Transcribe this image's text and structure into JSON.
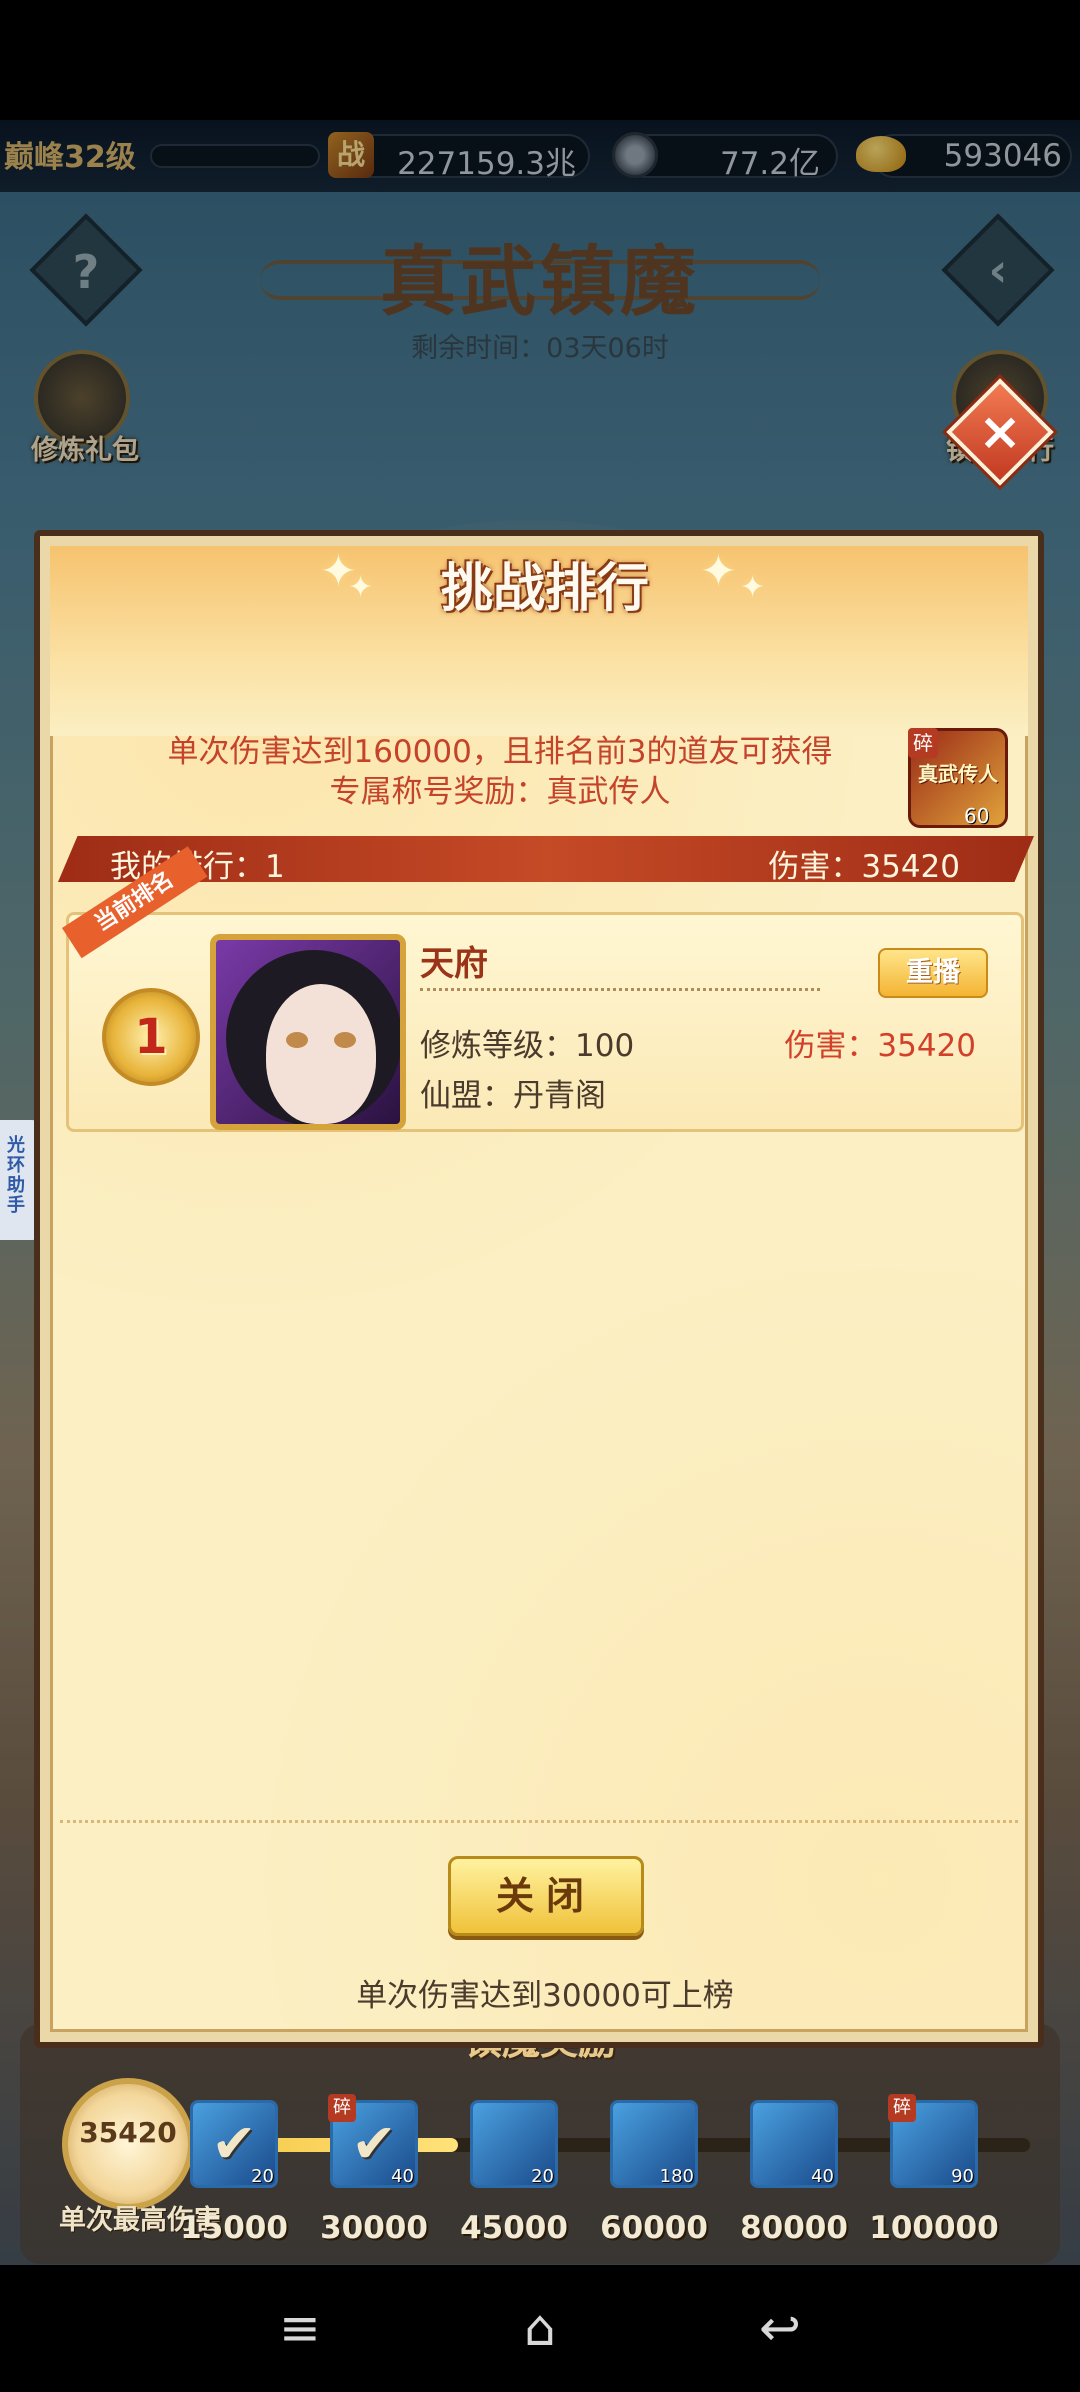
{
  "resources": {
    "level": "巅峰32级",
    "power_icon": "战",
    "power": "227159.3兆",
    "coins": "77.2亿",
    "ingots": "593046"
  },
  "header": {
    "title": "真武镇魔",
    "remaining_time": "剩余时间：03天06时"
  },
  "side": {
    "left_label": "修炼礼包",
    "right_label": "镇魔排行",
    "assist_tab": "光环助手"
  },
  "dialog": {
    "title": "挑战排行",
    "reward_line1": "单次伤害达到160000，且排名前3的道友可获得",
    "reward_line2": "专属称号奖励：真武传人",
    "badge_fragment": "碎",
    "badge_text": "真武传人",
    "badge_count": "60",
    "my_rank": "我的排行：1",
    "my_damage": "伤害：35420",
    "entry": {
      "ribbon": "当前排名",
      "rank": "1",
      "name": "天府",
      "level": "修炼等级：100",
      "alliance": "仙盟：丹青阁",
      "damage": "伤害：35420",
      "replay": "重播"
    },
    "close_button": "关闭",
    "threshold": "单次伤害达到30000可上榜"
  },
  "rewards": {
    "title": "镇魔奖励",
    "best_value": "35420",
    "best_label": "单次最高伤害",
    "progress": 0.35,
    "milestones": [
      {
        "value": "15000",
        "count": "20",
        "claimed": true,
        "fragment": false
      },
      {
        "value": "30000",
        "count": "40",
        "claimed": true,
        "fragment": true
      },
      {
        "value": "45000",
        "count": "20",
        "claimed": false,
        "fragment": false
      },
      {
        "value": "60000",
        "count": "180",
        "claimed": false,
        "fragment": false
      },
      {
        "value": "80000",
        "count": "40",
        "claimed": false,
        "fragment": false
      },
      {
        "value": "100000",
        "count": "90",
        "claimed": false,
        "fragment": true
      }
    ]
  },
  "colors": {
    "accent_red": "#c4432a",
    "rank_bar": "#9e2c16",
    "dialog_bg": "#fbefc3"
  },
  "icons": {
    "help": "question-icon",
    "back": "back-arrow-icon",
    "close": "close-icon",
    "nav_menu": "menu-icon",
    "nav_home": "home-icon",
    "nav_back": "back-icon"
  }
}
